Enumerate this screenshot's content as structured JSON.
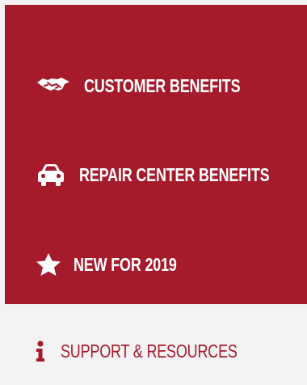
{
  "nav": {
    "items": [
      {
        "label": "CUSTOMER BENEFITS",
        "icon": "handshake-icon",
        "active": false
      },
      {
        "label": "REPAIR CENTER BENEFITS",
        "icon": "car-icon",
        "active": false
      },
      {
        "label": "NEW FOR 2019",
        "icon": "star-icon",
        "active": false
      },
      {
        "label": "SUPPORT & RESOURCES",
        "icon": "info-icon",
        "active": true
      }
    ]
  },
  "colors": {
    "brand_red": "#a51b2c",
    "background": "#f3f3f3",
    "text_on_red": "#ffffff"
  }
}
